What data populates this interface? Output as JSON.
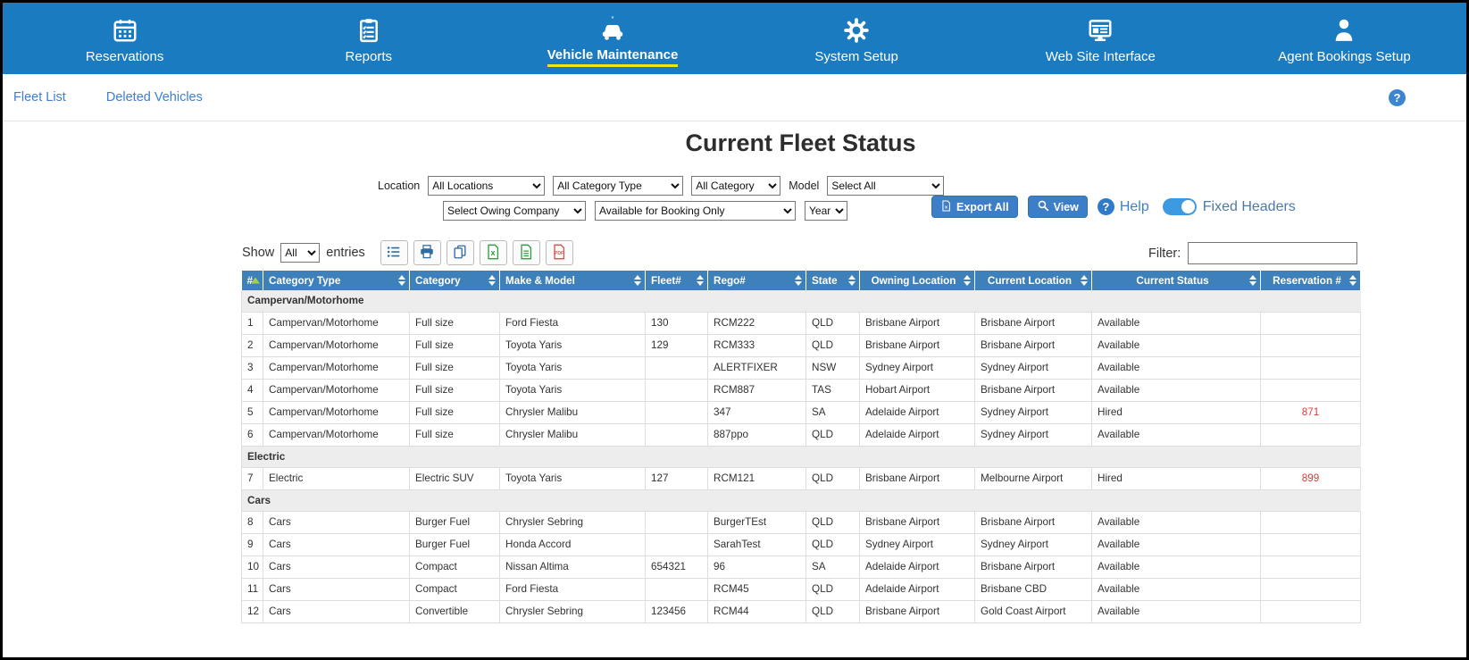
{
  "nav": {
    "items": [
      {
        "label": "Reservations"
      },
      {
        "label": "Reports"
      },
      {
        "label": "Vehicle Maintenance"
      },
      {
        "label": "System Setup"
      },
      {
        "label": "Web Site Interface"
      },
      {
        "label": "Agent Bookings Setup"
      }
    ],
    "active_index": 2
  },
  "subnav": {
    "fleet_list_label": "Fleet List",
    "deleted_vehicles_label": "Deleted Vehicles",
    "help_icon": "?"
  },
  "page": {
    "title": "Current Fleet Status"
  },
  "filters": {
    "location_label": "Location",
    "location_value": "All Locations",
    "category_type_value": "All Category Type",
    "category_value": "All Category",
    "model_label": "Model",
    "model_value": "Select All",
    "owning_company_value": "Select Owing Company",
    "availability_value": "Available for Booking Only",
    "year_value": "Year"
  },
  "actions": {
    "export_all_label": "Export All",
    "view_label": "View",
    "help_label": "Help",
    "help_icon": "?",
    "fixed_headers_label": "Fixed Headers",
    "fixed_headers_on": true
  },
  "toolbar": {
    "show_label": "Show",
    "show_value": "All",
    "entries_label": "entries",
    "filter_label": "Filter:",
    "filter_value": "",
    "icons": [
      "list-icon",
      "print-icon",
      "copy-icon",
      "excel-icon",
      "csv-icon",
      "pdf-icon"
    ]
  },
  "table": {
    "columns": [
      "#",
      "Category Type",
      "Category",
      "Make & Model",
      "Fleet#",
      "Rego#",
      "State",
      "Owning Location",
      "Current Location",
      "Current Status",
      "Reservation #"
    ],
    "sorted_column": "#",
    "groups": [
      {
        "name": "Campervan/Motorhome",
        "rows": [
          [
            "1",
            "Campervan/Motorhome",
            "Full size",
            "Ford Fiesta",
            "130",
            "RCM222",
            "QLD",
            "Brisbane Airport",
            "Brisbane Airport",
            "Available",
            ""
          ],
          [
            "2",
            "Campervan/Motorhome",
            "Full size",
            "Toyota Yaris",
            "129",
            "RCM333",
            "QLD",
            "Brisbane Airport",
            "Brisbane Airport",
            "Available",
            ""
          ],
          [
            "3",
            "Campervan/Motorhome",
            "Full size",
            "Toyota Yaris",
            "",
            "ALERTFIXER",
            "NSW",
            "Sydney Airport",
            "Sydney Airport",
            "Available",
            ""
          ],
          [
            "4",
            "Campervan/Motorhome",
            "Full size",
            "Toyota Yaris",
            "",
            "RCM887",
            "TAS",
            "Hobart Airport",
            "Brisbane Airport",
            "Available",
            ""
          ],
          [
            "5",
            "Campervan/Motorhome",
            "Full size",
            "Chrysler Malibu",
            "",
            "347",
            "SA",
            "Adelaide Airport",
            "Sydney Airport",
            "Hired",
            "871"
          ],
          [
            "6",
            "Campervan/Motorhome",
            "Full size",
            "Chrysler Malibu",
            "",
            "887ppo",
            "QLD",
            "Adelaide Airport",
            "Sydney Airport",
            "Available",
            ""
          ]
        ]
      },
      {
        "name": "Electric",
        "rows": [
          [
            "7",
            "Electric",
            "Electric SUV",
            "Toyota Yaris",
            "127",
            "RCM121",
            "QLD",
            "Brisbane Airport",
            "Melbourne Airport",
            "Hired",
            "899"
          ]
        ]
      },
      {
        "name": "Cars",
        "rows": [
          [
            "8",
            "Cars",
            "Burger Fuel",
            "Chrysler Sebring",
            "",
            "BurgerTEst",
            "QLD",
            "Brisbane Airport",
            "Brisbane Airport",
            "Available",
            ""
          ],
          [
            "9",
            "Cars",
            "Burger Fuel",
            "Honda Accord",
            "",
            "SarahTest",
            "QLD",
            "Sydney Airport",
            "Sydney Airport",
            "Available",
            ""
          ],
          [
            "10",
            "Cars",
            "Compact",
            "Nissan Altima",
            "654321",
            "96",
            "SA",
            "Adelaide Airport",
            "Brisbane Airport",
            "Available",
            ""
          ],
          [
            "11",
            "Cars",
            "Compact",
            "Ford Fiesta",
            "",
            "RCM45",
            "QLD",
            "Adelaide Airport",
            "Brisbane CBD",
            "Available",
            ""
          ],
          [
            "12",
            "Cars",
            "Convertible",
            "Chrysler Sebring",
            "123456",
            "RCM44",
            "QLD",
            "Brisbane Airport",
            "Gold Coast Airport",
            "Available",
            ""
          ]
        ]
      }
    ]
  },
  "colors": {
    "nav_bg": "#1b7bc0",
    "active_underline": "#ece719",
    "table_header_bg": "#3e81ba",
    "link": "#3d7fd1",
    "button_bg": "#3d7ec9",
    "reservation_red": "#e03b3b",
    "group_row_bg": "#ededed"
  }
}
